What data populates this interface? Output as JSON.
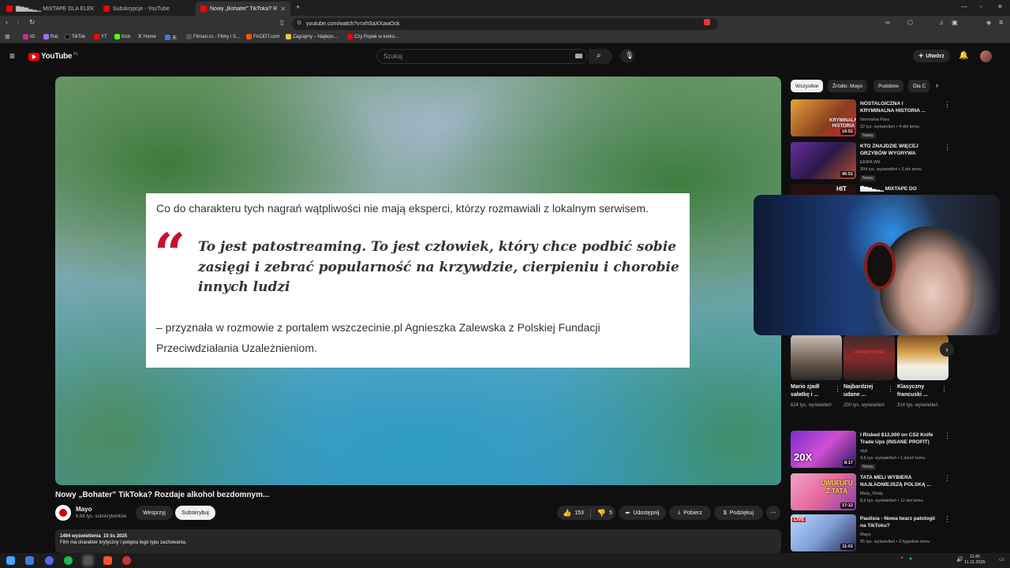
{
  "browser": {
    "tabs": [
      {
        "label": "▇▆▅▃▂▁ MIXTAPE DLA ELEK",
        "active": false
      },
      {
        "label": "Subskrypcje - YouTube",
        "active": false
      },
      {
        "label": "Nowy „Bohater” TikToka? Roz",
        "active": true
      }
    ],
    "new_tab": "+",
    "url": "youtube.com/watch?v=xhSaXXawOck",
    "bookmarks": [
      "IG",
      "Rat",
      "TikTok",
      "YT",
      "Kick",
      "Home",
      "天",
      "Filman.cc - Filmy i S...",
      "FACEIT.com",
      "Zagrajmy – Najleps...",
      "Czy Popek w korku..."
    ]
  },
  "youtube": {
    "logo": "YouTube",
    "region": "PL",
    "search_placeholder": "Szukaj",
    "create_label": "Utwórz"
  },
  "video": {
    "quote_intro": "Co do charakteru tych nagrań wątpliwości nie mają eksperci, którzy rozmawiali z lokalnym serwisem.",
    "quote_mark": "“",
    "quote_text": "To jest patostreaming. To jest człowiek, który chce podbić sobie zasięgi i zebrać popularność na krzywdzie, cierpieniu i chorobie innych ludzi",
    "quote_source": "– przyznała w rozmowie z portalem wszczecinie.pl Agnieszka Zalewska z Polskiej Fundacji Przeciwdziałania Uzależnieniom.",
    "title": "Nowy „Bohater” TikToka? Rozdaje alkohol bezdomnym...",
    "channel_name": "Mayo",
    "channel_subs": "6,68 tys. subskrybentów",
    "join_label": "Wesprzyj",
    "subscribe_label": "Subskrybuj",
    "likes": "153",
    "dislikes": "5",
    "share_label": "Udostępnij",
    "download_label": "Pobierz",
    "thanks_label": "Podziękuj",
    "views_date": "1494 wyświetlenia  10 lis 2025",
    "description": "Film ma charakter krytyczny i potępia tego typu zachowania."
  },
  "sidebar": {
    "chips": [
      "Wszystkie",
      "Źródło: Mayo",
      "Podobne",
      "Dla C"
    ],
    "recs": [
      {
        "title": "NOSTALGICZNA I KRYMINALNA HISTORIA ...",
        "channel": "Normalna Para",
        "meta": "22 tys. wyświetleń • 4 dni temu",
        "badge": "Nowy",
        "duration": "18:52",
        "thumb_text": "KRYMINALNA HISTORIA FLI"
      },
      {
        "title": "KTO ZNAJDZIE WIĘCEJ GRZYBÓW WYGRYWA *AFERA*",
        "channel": "EKIPA WK",
        "meta": "304 tys. wyświetleń • 2 dni temu",
        "badge": "Nowy",
        "duration": "46:51"
      },
      {
        "title": "▇▆▅▃▂▁ MIXTAPE DO",
        "thumb_text": "HIT"
      },
      {
        "title": "I Risked $12,000 on CS2 Knife Trade Ups (INSANE PROFIT)",
        "channel": "siyk",
        "meta": "4,6 tys. wyświetleń • 1 dzień temu",
        "badge": "Nowy",
        "duration": "8:17",
        "thumb_text": "20X"
      },
      {
        "title": "TATA MELI WYBIERA NAJŁADNIEJSZĄ POLSKĄ ...",
        "channel": "Mela_Shoty",
        "meta": "8,2 tys. wyświetleń • 12 dni temu",
        "duration": "17:12",
        "thumb_text": "UWUFUFU Z TATĄ"
      },
      {
        "title": "Paulisia - Nowa twarz patologii na TikToku?",
        "channel": "Mayo",
        "meta": "55 tys. wyświetleń • 2 tygodnie temu",
        "duration": "11:01",
        "thumb_text": "LIVE"
      }
    ],
    "shorts": [
      {
        "title": "Mario zjadł sałatkę i ...",
        "views": "624 tys. wyświetleń"
      },
      {
        "title": "Najbardziej udane ...",
        "views": "200 tys. wyświetleń",
        "thumb_text": "AUTENTYCZNE"
      },
      {
        "title": "Klasyczny francuski ...",
        "views": "314 tys. wyświetleń"
      }
    ]
  },
  "taskbar": {
    "time": "11:45",
    "date": "11.11.2025"
  }
}
